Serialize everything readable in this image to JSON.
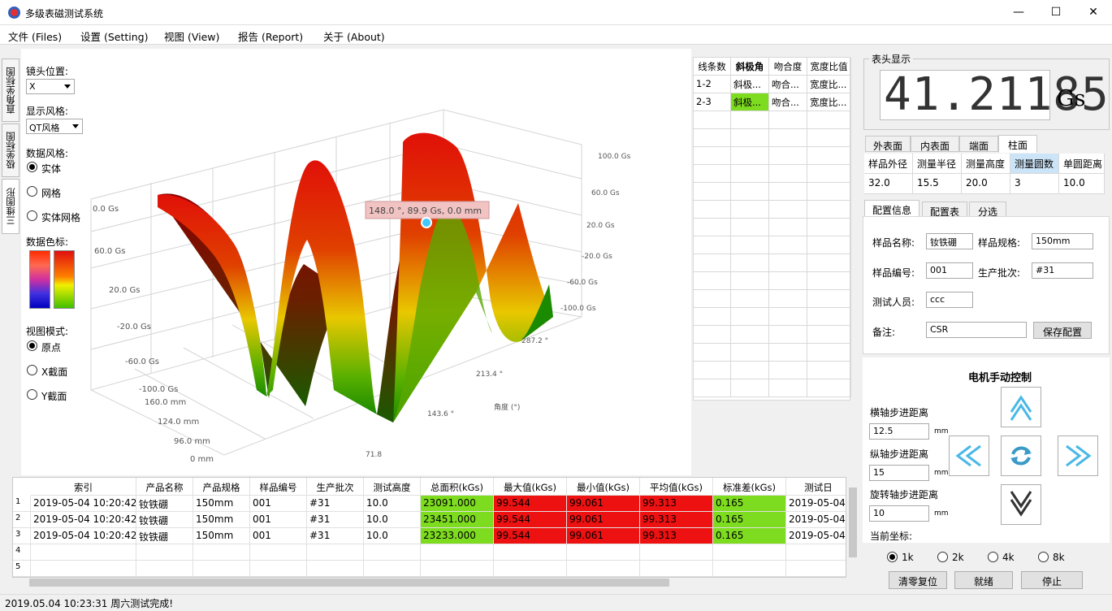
{
  "app": {
    "title": "多级表磁测试系统"
  },
  "window_controls": {
    "minimize": "—",
    "maximize": "☐",
    "close": "✕"
  },
  "menu": [
    "文件 (Files)",
    "设置 (Setting)",
    "视图 (View)",
    "报告 (Report)",
    "关于 (About)"
  ],
  "side_tabs": [
    "直角坐标图",
    "极坐标图",
    "三维图形"
  ],
  "controls": {
    "lens_label": "镜头位置:",
    "lens_value": "X",
    "style_label": "显示风格:",
    "style_value": "QT风格",
    "data_style_label": "数据风格:",
    "data_styles": [
      "实体",
      "网格",
      "实体网格"
    ],
    "data_style_selected": "实体",
    "colorbar_label": "数据色标:",
    "view_mode_label": "视图模式:",
    "view_modes": [
      "原点",
      "X截面",
      "Y截面"
    ],
    "view_mode_selected": "原点"
  },
  "plot": {
    "tooltip": "148.0 °, 89.9 Gs, 0.0 mm",
    "z_ticks_left": [
      "0.0 Gs",
      "60.0 Gs",
      "20.0 Gs",
      "-20.0 Gs",
      "-60.0 Gs",
      "-100.0 Gs"
    ],
    "z_ticks_right": [
      "100.0 Gs",
      "60.0 Gs",
      "20.0 Gs",
      "-20.0 Gs",
      "-60.0 Gs",
      "-100.0 Gs"
    ],
    "x_ticks": [
      "160.0 mm",
      "124.0 mm",
      "96.0 mm",
      "0 mm"
    ],
    "angle_ticks": [
      "287.2 °",
      "213.4 °",
      "143.6 °",
      "71.8"
    ],
    "angle_axis_title": "角度 (°)"
  },
  "lines_table": {
    "headers": [
      "线条数",
      "斜极角",
      "吻合度",
      "宽度比值"
    ],
    "rows": [
      [
        "1-2",
        "斜极...",
        "吻合...",
        "宽度比..."
      ],
      [
        "2-3",
        "斜极...",
        "吻合...",
        "宽度比..."
      ]
    ],
    "highlight": "#7ddc1f"
  },
  "gauge": {
    "title": "表头显示",
    "value": "41.21185",
    "unit": "Gs"
  },
  "surface_tabs": [
    "外表面",
    "内表面",
    "端面",
    "柱面"
  ],
  "surface_tab_active": "柱面",
  "sample_table": {
    "headers": [
      "样品外径",
      "测量半径",
      "测量高度",
      "测量圆数",
      "单圆距离"
    ],
    "values": [
      "32.0",
      "15.5",
      "20.0",
      "3",
      "10.0"
    ]
  },
  "config_tabs": [
    "配置信息",
    "配置表",
    "分选"
  ],
  "config": {
    "name_label": "样品名称:",
    "name_value": "钕铁硼",
    "spec_label": "样品规格:",
    "spec_value": "150mm",
    "code_label": "样品编号:",
    "code_value": "001",
    "batch_label": "生产批次:",
    "batch_value": "#31",
    "tester_label": "测试人员:",
    "tester_value": "ccc",
    "note_label": "备注:",
    "note_value": "CSR",
    "save_button": "保存配置"
  },
  "motor": {
    "title": "电机手动控制",
    "h_step_label": "横轴步进距离",
    "h_step_value": "12.5",
    "v_step_label": "纵轴步进距离",
    "v_step_value": "15",
    "r_step_label": "旋转轴步进距离",
    "r_step_value": "10",
    "unit": "mm",
    "coord_label": "当前坐标:",
    "speeds": [
      "1k",
      "2k",
      "4k",
      "8k"
    ],
    "speed_selected": "1k",
    "reset_button": "清零复位",
    "ready_button": "就绪",
    "stop_button": "停止"
  },
  "data_table": {
    "headers": [
      "索引",
      "产品名称",
      "产品规格",
      "样品编号",
      "生产批次",
      "测试高度",
      "总面积(kGs)",
      "最大值(kGs)",
      "最小值(kGs)",
      "平均值(kGs)",
      "标准差(kGs)",
      "测试日"
    ],
    "rows": [
      [
        "2019-05-04 10:20:42",
        "钕铁硼",
        "150mm",
        "001",
        "#31",
        "10.0",
        "23091.000",
        "99.544",
        "99.061",
        "99.313",
        "0.165",
        "2019-05-04"
      ],
      [
        "2019-05-04 10:20:42",
        "钕铁硼",
        "150mm",
        "001",
        "#31",
        "10.0",
        "23451.000",
        "99.544",
        "99.061",
        "99.313",
        "0.165",
        "2019-05-04"
      ],
      [
        "2019-05-04 10:20:42",
        "钕铁硼",
        "150mm",
        "001",
        "#31",
        "10.0",
        "23233.000",
        "99.544",
        "99.061",
        "99.313",
        "0.165",
        "2019-05-04"
      ]
    ],
    "row_numbers": [
      "1",
      "2",
      "3",
      "4",
      "5"
    ],
    "green": "#7ddc1f",
    "red": "#ee1111"
  },
  "status": "2019.05.04 10:23:31 周六测试完成!"
}
